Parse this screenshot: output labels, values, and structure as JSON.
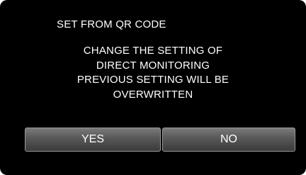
{
  "dialog": {
    "title": "SET FROM QR CODE",
    "message_lines": [
      "CHANGE THE SETTING OF",
      "DIRECT MONITORING",
      "PREVIOUS SETTING WILL BE",
      "OVERWRITTEN"
    ]
  },
  "buttons": {
    "yes_label": "YES",
    "no_label": "NO"
  },
  "colors": {
    "background": "#000000",
    "text": "#ffffff",
    "button_border": "#9a9a9a"
  }
}
